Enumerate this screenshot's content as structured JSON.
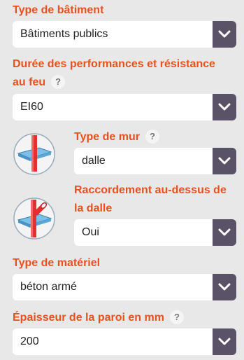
{
  "fields": {
    "building_type": {
      "label": "Type de bâtiment",
      "value": "Bâtiments publics"
    },
    "fire_resistance": {
      "label_line1": "Durée des performances et résistance",
      "label_line2": "au feu",
      "value": "EI60"
    },
    "wall_type": {
      "label": "Type de mur",
      "value": "dalle"
    },
    "connection_above": {
      "label_line1": "Raccordement au-dessus de",
      "label_line2": "la dalle",
      "value": "Oui"
    },
    "material_type": {
      "label": "Type de matériel",
      "value": "béton armé"
    },
    "wall_thickness": {
      "label": "Épaisseur de la paroi en mm",
      "value": "200"
    }
  },
  "help_glyph": "?",
  "colors": {
    "label": "#e8501e",
    "arrow_bg": "#5a5368",
    "background": "#e8e8e8",
    "pipe": "#e03030",
    "slab": "#5aa7d8"
  }
}
